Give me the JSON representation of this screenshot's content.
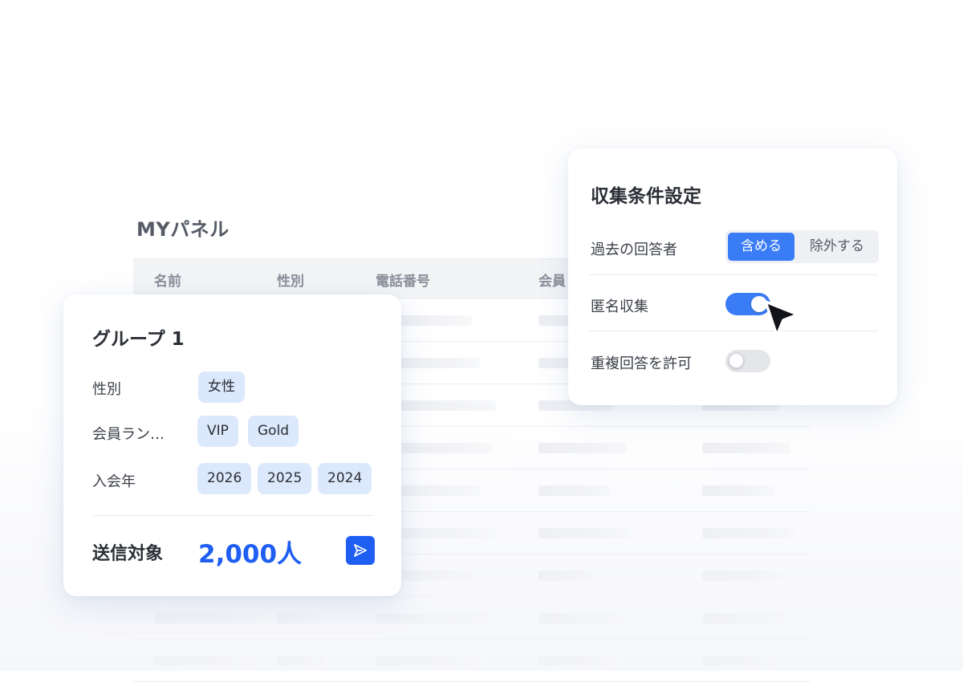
{
  "panel": {
    "title": "MYパネル",
    "columns": [
      "名前",
      "性別",
      "電話番号",
      "会員"
    ]
  },
  "group": {
    "title": "グループ 1",
    "fields": [
      {
        "label": "性別",
        "chips": [
          "女性"
        ]
      },
      {
        "label": "会員ラン…",
        "chips": [
          "VIP",
          "Gold"
        ]
      },
      {
        "label": "入会年",
        "chips": [
          "2026",
          "2025",
          "2024"
        ]
      }
    ],
    "target_label": "送信対象",
    "target_count": "2,000人",
    "send_icon": "send-icon"
  },
  "settings": {
    "title": "収集条件設定",
    "past_respondents": {
      "label": "過去の回答者",
      "options": [
        "含める",
        "除外する"
      ],
      "selected": "含める"
    },
    "anonymous": {
      "label": "匿名収集",
      "state": "on"
    },
    "duplicate": {
      "label": "重複回答を許可",
      "state": "off"
    }
  },
  "colors": {
    "accent": "#1e5ef2",
    "toggle_on": "#3a7cf5",
    "chip_bg": "#dce8fb"
  }
}
